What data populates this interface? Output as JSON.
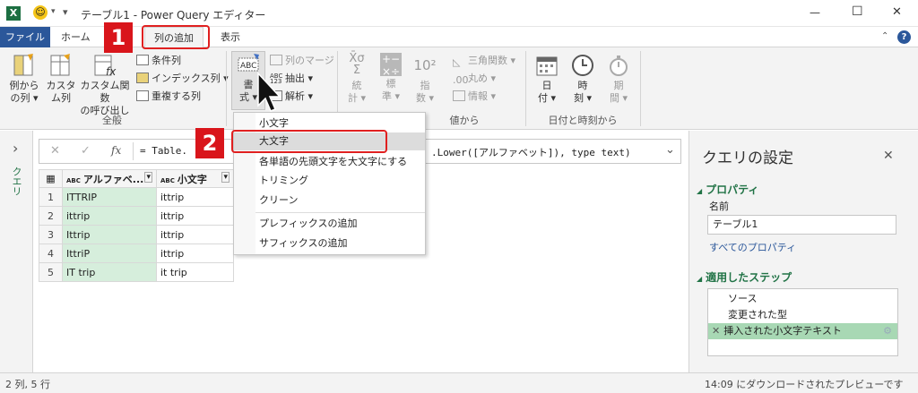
{
  "title": "テーブル1 - Power Query エディター",
  "tabs": {
    "file": "ファイル",
    "home": "ホーム",
    "add_column": "列の追加",
    "view": "表示"
  },
  "ribbon": {
    "example_col": [
      "例から",
      "の列 ▾"
    ],
    "custom_col": [
      "カスタ",
      "ム列"
    ],
    "invoke_func": [
      "カスタム関数",
      "の呼び出し"
    ],
    "conditional": "条件列",
    "index": "インデックス列 ▾",
    "duplicate": "重複する列",
    "group_general": "全般",
    "format_btn": [
      "書",
      "式 ▾"
    ],
    "merge": "列のマージ",
    "extract": "抽出 ▾",
    "parse": "解析 ▾",
    "stats": [
      "統",
      "計 ▾"
    ],
    "standard": [
      "標",
      "準 ▾"
    ],
    "scientific": [
      "指",
      "数 ▾"
    ],
    "trig": "三角関数 ▾",
    "round": "丸め ▾",
    "info": "情報 ▾",
    "group_number": "値から",
    "date": [
      "日",
      "付 ▾"
    ],
    "time": [
      "時",
      "刻 ▾"
    ],
    "duration": [
      "期",
      "間 ▾"
    ],
    "group_datetime": "日付と時刻から"
  },
  "formula": {
    "fx": "fx",
    "left_text": "= Table.",
    "right_text": ".Lower([アルファベット]), type text)"
  },
  "table": {
    "col1_header": "アルファベ...",
    "col2_header": "小文字",
    "type_icon": "ABC",
    "rows": [
      {
        "n": "1",
        "a": "ITTRIP",
        "b": "ittrip"
      },
      {
        "n": "2",
        "a": "ittrip",
        "b": "ittrip"
      },
      {
        "n": "3",
        "a": "Ittrip",
        "b": "ittrip"
      },
      {
        "n": "4",
        "a": "IttriP",
        "b": "ittrip"
      },
      {
        "n": "5",
        "a": "IT trip",
        "b": "it trip"
      }
    ]
  },
  "menu": {
    "items": [
      "小文字",
      "大文字",
      "各単語の先頭文字を大文字にする",
      "トリミング",
      "クリーン",
      "プレフィックスの追加",
      "サフィックスの追加"
    ]
  },
  "leftnav": {
    "label": "クエリ",
    "arrow": "›"
  },
  "pane": {
    "title": "クエリの設定",
    "close": "✕",
    "properties": "プロパティ",
    "name_label": "名前",
    "name_value": "テーブル1",
    "all_props": "すべてのプロパティ",
    "steps_title": "適用したステップ",
    "steps": [
      "ソース",
      "変更された型",
      "挿入された小文字テキスト"
    ]
  },
  "status": {
    "left": "2 列, 5 行",
    "right": "14:09 にダウンロードされたプレビューです"
  },
  "badges": [
    "1",
    "2"
  ],
  "window": {
    "min": "—",
    "max": "☐",
    "close": "✕"
  },
  "colors": {
    "accent": "#217346",
    "file_tab": "#2b579a",
    "badge": "#d9151b",
    "selected_row": "#d6eedc"
  }
}
